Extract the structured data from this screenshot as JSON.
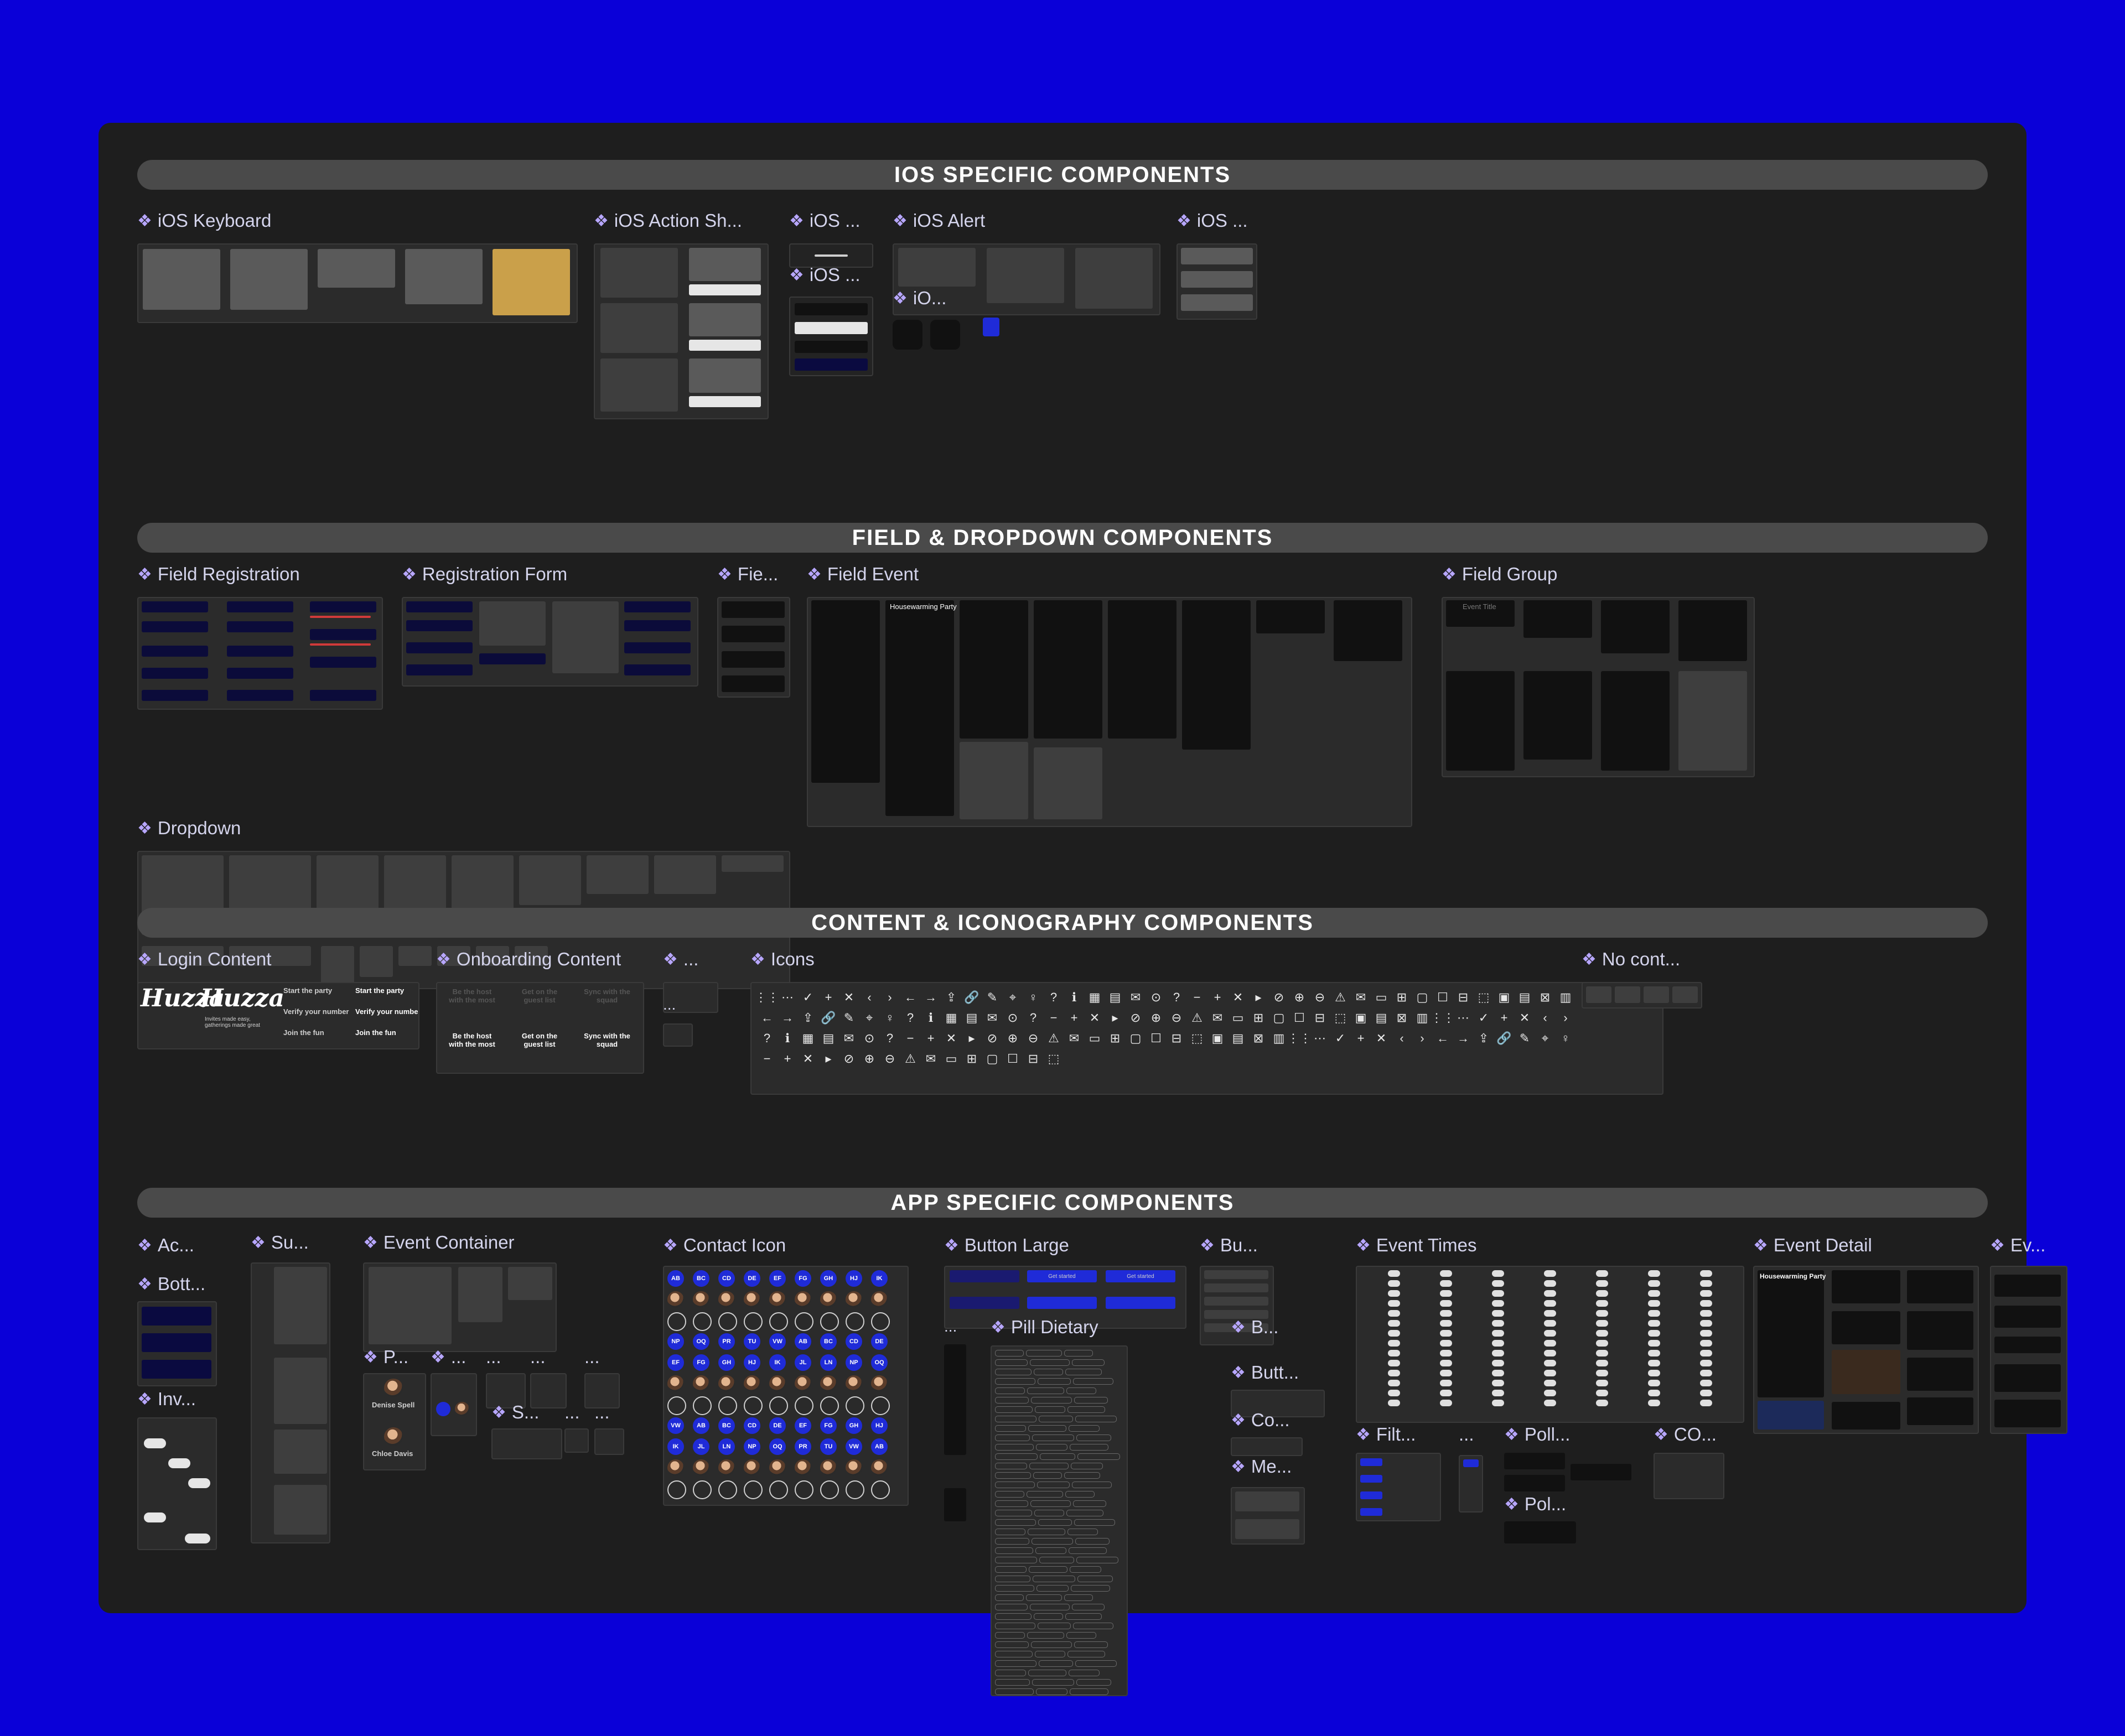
{
  "bands": {
    "ios": "IOS SPECIFIC COMPONENTS",
    "field": "FIELD & DROPDOWN COMPONENTS",
    "content": "CONTENT & ICONOGRAPHY COMPONENTS",
    "app": "APP SPECIFIC COMPONENTS"
  },
  "ios_labels": {
    "keyboard": "iOS Keyboard",
    "action_sheet": "iOS Action Sh...",
    "ios1": "iOS ...",
    "ios2": "iOS ...",
    "alert": "iOS Alert",
    "io": "iO...",
    "ios3": "iOS ..."
  },
  "field_labels": {
    "field_registration": "Field Registration",
    "registration_form": "Registration Form",
    "fie": "Fie...",
    "field_event": "Field Event",
    "field_group": "Field Group",
    "dropdown": "Dropdown"
  },
  "content_labels": {
    "login": "Login Content",
    "onboarding": "Onboarding Content",
    "ellipsis": "...",
    "icons": "Icons",
    "no_content": "No cont..."
  },
  "login": {
    "logo": "Huzza",
    "tagline": "Invites made easy, gatherings made great",
    "cards": [
      "Start the party",
      "Verify your number",
      "Join the fun"
    ]
  },
  "onboarding": {
    "cards": [
      "Be the host with the most",
      "Get on the guest list",
      "Sync with the squad"
    ]
  },
  "field_event": {
    "title": "Housewarming Party"
  },
  "field_group": {
    "event_title": "Event Title"
  },
  "app_labels": {
    "ac": "Ac...",
    "bott": "Bott...",
    "inv": "Inv...",
    "su": "Su...",
    "event_container": "Event Container",
    "p": "P...",
    "dots1": "...",
    "dots2": "...",
    "dots3": "...",
    "dots4": "...",
    "s": "S...",
    "dots5": "...",
    "dots6": "...",
    "contact_icon": "Contact Icon",
    "button_large": "Button Large",
    "pill_dietary": "Pill Dietary",
    "bu": "Bu...",
    "b": "B...",
    "butt": "Butt...",
    "co": "Co...",
    "me": "Me...",
    "event_times": "Event Times",
    "filt": "Filt...",
    "poll1": "Poll...",
    "poll2": "Pol...",
    "co2": "CO...",
    "event_detail": "Event Detail",
    "ev": "Ev...",
    "dots7": "...",
    "dots8": "..."
  },
  "people": [
    "Denise Spell",
    "Chloe Davis"
  ],
  "contact_initials": [
    "AB",
    "BC",
    "CD",
    "DE",
    "EF",
    "FG",
    "GH",
    "HJ",
    "IK",
    "JL",
    "LN",
    "NP",
    "OQ",
    "PR",
    "TU",
    "VW"
  ],
  "button_large": {
    "primary": "Get started",
    "secondary": "Get started"
  },
  "event_detail": {
    "title": "Housewarming Party"
  },
  "icon_glyphs": [
    "⋮⋮",
    "⋯",
    "✓",
    "+",
    "✕",
    "‹",
    "›",
    "←",
    "→",
    "⇪",
    "🔗",
    "✎",
    "⌖",
    "♀",
    "?",
    "ℹ",
    "▦",
    "▤",
    "✉",
    "⊙",
    "?",
    "−",
    "+",
    "✕",
    "▸",
    "⊘",
    "⊕",
    "⊖",
    "⚠",
    "✉",
    "▭",
    "⊞",
    "▢",
    "☐",
    "⊟",
    "⬚",
    "▣",
    "▤",
    "⊠",
    "▥"
  ]
}
